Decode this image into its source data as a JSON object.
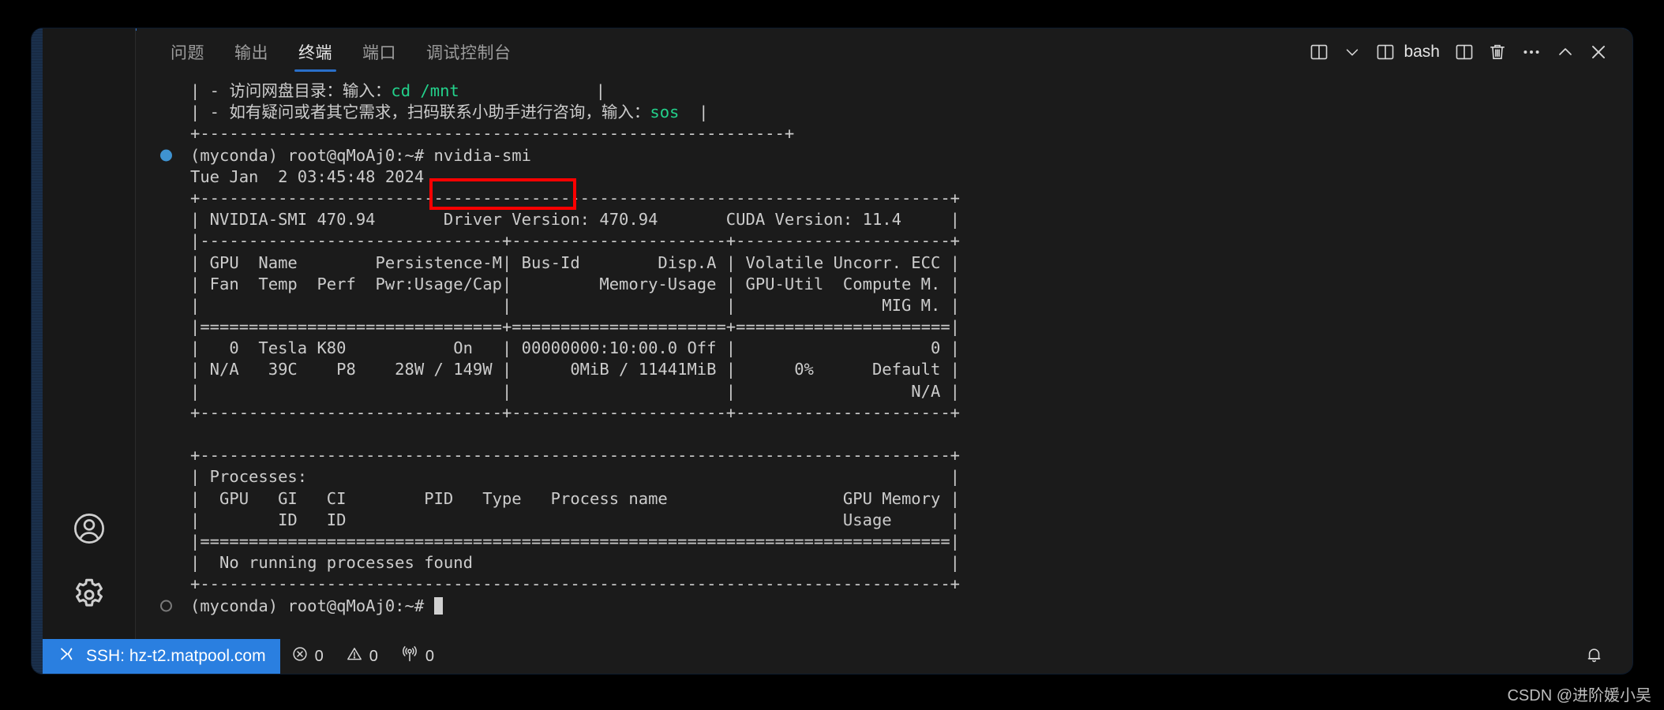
{
  "window": {
    "background_color": "#000000",
    "shell_color": "#1c1c1c",
    "accent_color": "#2a6fc9"
  },
  "activity_bar": {
    "items": [
      {
        "name": "account-icon",
        "label": "账户"
      },
      {
        "name": "settings-gear-icon",
        "label": "管理"
      }
    ]
  },
  "panel": {
    "tabs": [
      {
        "label": "问题",
        "active": false
      },
      {
        "label": "输出",
        "active": false
      },
      {
        "label": "终端",
        "active": true
      },
      {
        "label": "端口",
        "active": false
      },
      {
        "label": "调试控制台",
        "active": false
      }
    ],
    "actions": {
      "split_dropdown_label": "",
      "shell_label": "bash",
      "split_label": "",
      "kill_label": "",
      "more_label": "···",
      "maximize_label": "",
      "close_label": ""
    }
  },
  "terminal": {
    "prompt_user": "(myconda) root@qMoAj0:~#",
    "command": " nvidia-smi",
    "cursor_visible": true,
    "lines": [
      {
        "text": "| - 访问网盘目录：输入：",
        "green_tail": "cd /mnt",
        "tail_after": "              |",
        "marker": ""
      },
      {
        "text": "| - 如有疑问或者其它需求，扫码联系小助手进行咨询，输入：",
        "green_tail": "sos",
        "tail_after": "  |",
        "marker": ""
      },
      {
        "text": "+------------------------------------------------------------+",
        "marker": ""
      },
      {
        "text": "(myconda) root@qMoAj0:~# nvidia-smi",
        "marker": "filled"
      },
      {
        "text": "Tue Jan  2 03:45:48 2024",
        "marker": ""
      },
      {
        "text": "+-----------------------------------------------------------------------------+",
        "marker": ""
      },
      {
        "text": "| NVIDIA-SMI 470.94       Driver Version: 470.94       CUDA Version: 11.4     |",
        "marker": ""
      },
      {
        "text": "|-------------------------------+----------------------+----------------------+",
        "marker": ""
      },
      {
        "text": "| GPU  Name        Persistence-M| Bus-Id        Disp.A | Volatile Uncorr. ECC |",
        "marker": ""
      },
      {
        "text": "| Fan  Temp  Perf  Pwr:Usage/Cap|         Memory-Usage | GPU-Util  Compute M. |",
        "marker": ""
      },
      {
        "text": "|                               |                      |               MIG M. |",
        "marker": ""
      },
      {
        "text": "|===============================+======================+======================|",
        "marker": ""
      },
      {
        "text": "|   0  Tesla K80           On   | 00000000:10:00.0 Off |                    0 |",
        "marker": ""
      },
      {
        "text": "| N/A   39C    P8    28W / 149W |      0MiB / 11441MiB |      0%      Default |",
        "marker": ""
      },
      {
        "text": "|                               |                      |                  N/A |",
        "marker": ""
      },
      {
        "text": "+-------------------------------+----------------------+----------------------+",
        "marker": ""
      },
      {
        "text": "",
        "marker": ""
      },
      {
        "text": "+-----------------------------------------------------------------------------+",
        "marker": ""
      },
      {
        "text": "| Processes:                                                                  |",
        "marker": ""
      },
      {
        "text": "|  GPU   GI   CI        PID   Type   Process name                  GPU Memory |",
        "marker": ""
      },
      {
        "text": "|        ID   ID                                                   Usage      |",
        "marker": ""
      },
      {
        "text": "|=============================================================================|",
        "marker": ""
      },
      {
        "text": "|  No running processes found                                                 |",
        "marker": ""
      },
      {
        "text": "+-----------------------------------------------------------------------------+",
        "marker": ""
      },
      {
        "text": "(myconda) root@qMoAj0:~# ",
        "marker": "hollow",
        "cursor": true
      }
    ]
  },
  "status_bar": {
    "remote_label": "SSH: hz-t2.matpool.com",
    "errors_count": "0",
    "warnings_count": "0",
    "ports_count": "0",
    "bell_label": ""
  },
  "watermark": {
    "text": "CSDN @进阶媛小吴"
  },
  "gpu_report": {
    "timestamp": "Tue Jan  2 03:45:48 2024",
    "nvidia_smi_version": "470.94",
    "driver_version": "470.94",
    "cuda_version": "11.4",
    "gpus": [
      {
        "index": "0",
        "name": "Tesla K80",
        "persistence_m": "On",
        "bus_id": "00000000:10:00.0",
        "disp_a": "Off",
        "uncorr_ecc": "0",
        "fan": "N/A",
        "temp": "39C",
        "perf": "P8",
        "pwr_usage_cap": "28W / 149W",
        "memory_usage": "0MiB / 11441MiB",
        "gpu_util": "0%",
        "compute_m": "Default",
        "mig_m": "N/A"
      }
    ],
    "processes_message": "No running processes found"
  }
}
